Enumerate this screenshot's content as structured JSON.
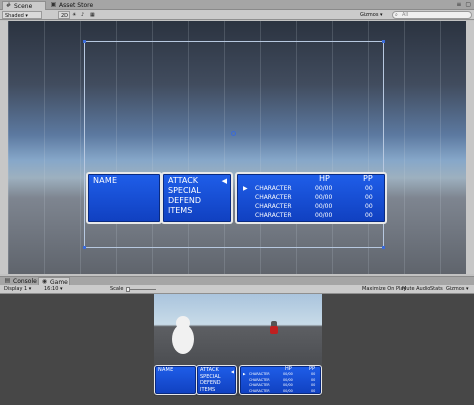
{
  "scene_tabs": [
    {
      "icon": "scene-icon",
      "label": "Scene"
    },
    {
      "icon": "asset-store-icon",
      "label": "Asset Store"
    }
  ],
  "scene_toolbar": {
    "shading": "Shaded",
    "mode_2d": "2D",
    "gizmos": "Gizmos",
    "search_placeholder": "All"
  },
  "battle_ui": {
    "name_label": "NAME",
    "commands": [
      "ATTACK",
      "SPECIAL",
      "DEFEND",
      "ITEMS"
    ],
    "cursor": "◀",
    "hp_header": "HP",
    "pp_header": "PP",
    "row_cursor": "▶",
    "characters": [
      {
        "name": "CHARACTER",
        "hp": "00/00",
        "pp": "00"
      },
      {
        "name": "CHARACTER",
        "hp": "00/00",
        "pp": "00"
      },
      {
        "name": "CHARACTER",
        "hp": "00/00",
        "pp": "00"
      },
      {
        "name": "CHARACTER",
        "hp": "00/00",
        "pp": "00"
      }
    ]
  },
  "game_tabs": [
    {
      "icon": "console-icon",
      "label": "Console"
    },
    {
      "icon": "game-icon",
      "label": "Game"
    }
  ],
  "game_toolbar": {
    "display": "Display 1",
    "aspect": "16:10",
    "scale_label": "Scale",
    "maximize": "Maximize On Play",
    "mute": "Mute Audio",
    "stats": "Stats",
    "gizmos": "Gizmos"
  },
  "colors": {
    "panel_blue": "#1f5ee9",
    "selection_blue": "#3a6ad8",
    "robot_red": "#c02020"
  }
}
